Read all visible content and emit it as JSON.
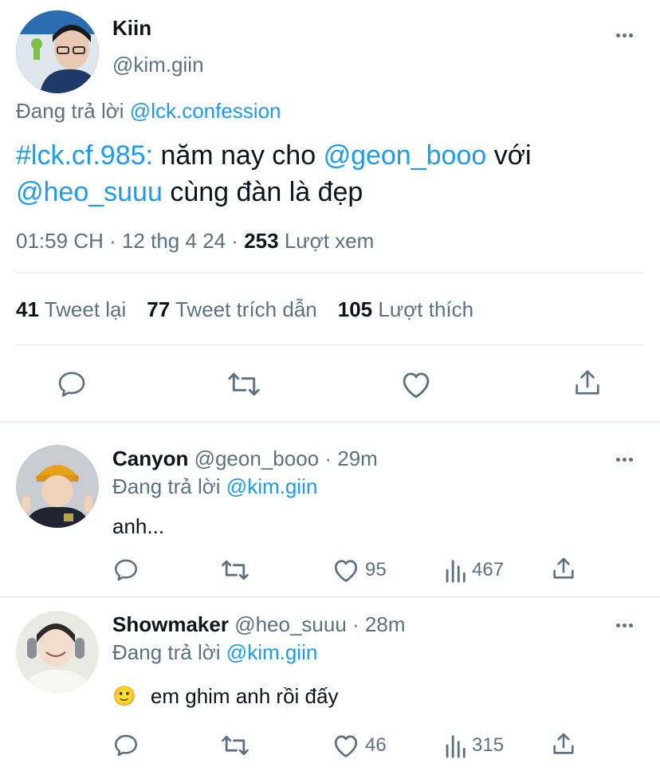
{
  "main_tweet": {
    "name": "Kiin",
    "handle": "@kim.giin",
    "reply_prefix": "Đang trả lời",
    "reply_to": "@lck.confession",
    "text_hashtag": "#lck.cf.985:",
    "text_part1": "năm nay cho",
    "text_mention1": "@geon_booo",
    "text_part2": "với",
    "text_mention2": "@heo_suuu",
    "text_part3": "cùng đàn là đẹp",
    "meta_time": "01:59 CH · 12 thg 4 24 ·",
    "views_count": "253",
    "views_label": "Lượt xem",
    "retweets_count": "41",
    "retweets_label": "Tweet lại",
    "quotes_count": "77",
    "quotes_label": "Tweet trích dẫn",
    "likes_count": "105",
    "likes_label": "Lượt thích"
  },
  "replies": [
    {
      "name": "Canyon",
      "handle": "@geon_booo",
      "time": "· 29m",
      "reply_prefix": "Đang trả lời",
      "reply_to": "@kim.giin",
      "text": "anh...",
      "likes": "95",
      "views": "467"
    },
    {
      "name": "Showmaker",
      "handle": "@heo_suuu",
      "time": "· 28m",
      "reply_prefix": "Đang trả lời",
      "reply_to": "@kim.giin",
      "emoji": "🙂",
      "text": "em ghim anh rồi đấy",
      "likes": "46",
      "views": "315"
    }
  ],
  "colors": {
    "link_blue": "#1d9bf0",
    "secondary_text": "#5b7083",
    "primary_text": "#0f1419",
    "divider": "#dbe1e6"
  },
  "icons": [
    "reply-icon",
    "retweet-icon",
    "like-icon",
    "share-icon",
    "views-icon",
    "more-icon"
  ]
}
